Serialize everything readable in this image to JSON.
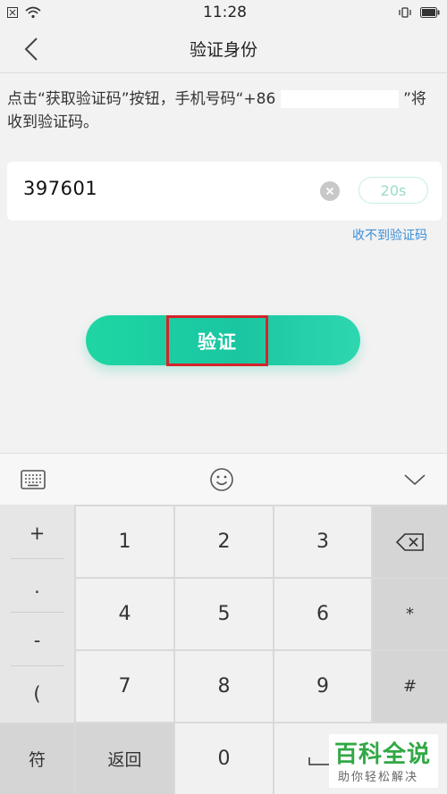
{
  "status_bar": {
    "time": "11:28",
    "left_icons": [
      "sim-icon",
      "wifi-icon"
    ],
    "right_icons": [
      "vibrate-icon",
      "battery-icon"
    ]
  },
  "nav": {
    "title": "验证身份",
    "back_icon": "chevron-left-icon"
  },
  "instruction": {
    "text_before": "点击“获取验证码”按钮，手机号码“+86",
    "text_after": "”将收到验证码。"
  },
  "code_input": {
    "value": "397601",
    "clear_icon": "clear-icon",
    "countdown": "20s"
  },
  "resend_link": "收不到验证码",
  "verify_button": {
    "label": "验证"
  },
  "keyboard": {
    "toolbar_icons": [
      "keyboard-icon",
      "emoji-icon",
      "chevron-down-icon"
    ],
    "symbol_keys": [
      "+",
      ".",
      "-",
      "("
    ],
    "rows": [
      [
        "1",
        "2",
        "3"
      ],
      [
        "4",
        "5",
        "6"
      ],
      [
        "7",
        "8",
        "9"
      ]
    ],
    "right_keys": [
      "*",
      "#"
    ],
    "bottom_keys": {
      "symbol": "符",
      "back": "返回",
      "zero": "0"
    }
  },
  "watermark": {
    "title": "百科全说",
    "subtitle": "助你轻松解决"
  },
  "colors": {
    "accent": "#19c6a1",
    "link": "#3b8fd8",
    "highlight": "#d6232a"
  }
}
